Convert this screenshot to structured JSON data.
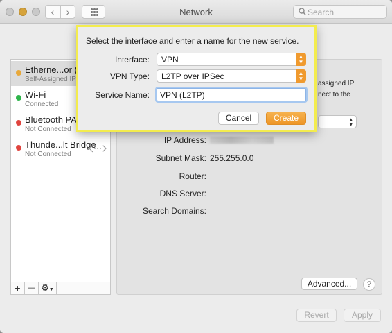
{
  "window": {
    "title": "Network",
    "search_placeholder": "Search"
  },
  "services": [
    {
      "name": "Etherne...or (e",
      "status": "Self-Assigned IP",
      "color": "#e8a83a"
    },
    {
      "name": "Wi-Fi",
      "status": "Connected",
      "color": "#2fb54b"
    },
    {
      "name": "Bluetooth PAN",
      "status": "Not Connected",
      "color": "#e0443e"
    },
    {
      "name": "Thunde...lt Bridge",
      "status": "Not Connected",
      "color": "#e0443e"
    }
  ],
  "sidebar_footer": {
    "add": "+",
    "remove": "—",
    "gear": "⚙"
  },
  "detail": {
    "partial_text_1": "assigned IP",
    "partial_text_2": "nect to the",
    "ip_label": "IP Address:",
    "subnet_label": "Subnet Mask:",
    "subnet_value": "255.255.0.0",
    "router_label": "Router:",
    "dns_label": "DNS Server:",
    "search_domains_label": "Search Domains:",
    "advanced_button": "Advanced...",
    "help_button": "?"
  },
  "bottom": {
    "revert": "Revert",
    "apply": "Apply"
  },
  "dialog": {
    "prompt": "Select the interface and enter a name for the new service.",
    "interface_label": "Interface:",
    "interface_value": "VPN",
    "vpn_type_label": "VPN Type:",
    "vpn_type_value": "L2TP over IPSec",
    "service_name_label": "Service Name:",
    "service_name_value": "VPN (L2TP)",
    "cancel_button": "Cancel",
    "create_button": "Create",
    "highlight_color": "#f3ec4e",
    "accent_color": "#f09a2e"
  }
}
